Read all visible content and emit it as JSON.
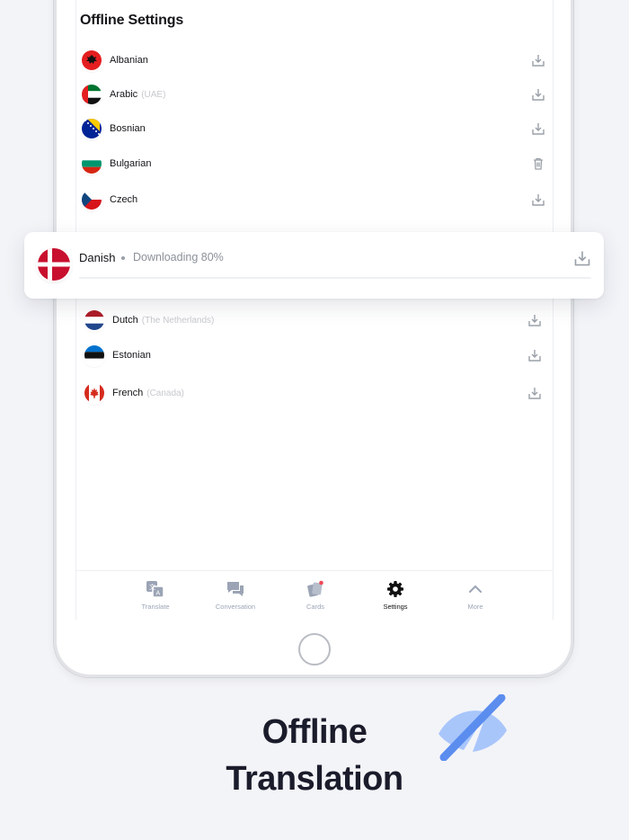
{
  "screen": {
    "title": "Offline Settings",
    "languages": [
      {
        "name": "Albanian",
        "sub": "",
        "flag": "albania",
        "action": "download-icon"
      },
      {
        "name": "Arabic",
        "sub": "(UAE)",
        "flag": "uae",
        "action": "download-icon"
      },
      {
        "name": "Bosnian",
        "sub": "",
        "flag": "bosnia",
        "action": "download-icon"
      },
      {
        "name": "Bulgarian",
        "sub": "",
        "flag": "bulgaria",
        "action": "trash-icon"
      },
      {
        "name": "Czech",
        "sub": "",
        "flag": "czech",
        "action": "download-icon"
      },
      {
        "name": "Dutch",
        "sub": "(The Netherlands)",
        "flag": "netherlands",
        "action": "download-icon"
      },
      {
        "name": "Estonian",
        "sub": "",
        "flag": "estonia",
        "action": "download-icon"
      },
      {
        "name": "French",
        "sub": "(Canada)",
        "flag": "canada",
        "action": "download-icon"
      }
    ],
    "downloading": {
      "name": "Danish",
      "status": "Downloading 80%",
      "progress": 0.8,
      "flag": "denmark",
      "action": "download-icon"
    }
  },
  "tabs": [
    {
      "label": "Translate",
      "icon": "translate-icon",
      "active": false
    },
    {
      "label": "Conversation",
      "icon": "conversation-icon",
      "active": false
    },
    {
      "label": "Cards",
      "icon": "cards-icon",
      "active": false
    },
    {
      "label": "Settings",
      "icon": "gear-icon",
      "active": true
    },
    {
      "label": "More",
      "icon": "chevron-up-icon",
      "active": false
    }
  ],
  "headline": {
    "line1": "Offline",
    "line2": "Translation"
  },
  "colors": {
    "accent_blue": "#5b8def",
    "icon_gray": "#9ba4b5",
    "background": "#f3f4f8",
    "headline": "#1b1c2b"
  }
}
